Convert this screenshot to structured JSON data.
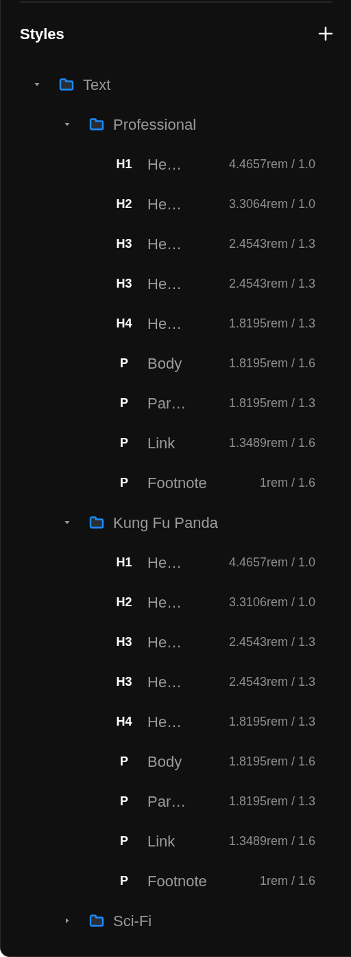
{
  "panel": {
    "title": "Styles"
  },
  "tree": [
    {
      "kind": "folder",
      "label": "Text",
      "expanded": true,
      "children": [
        {
          "kind": "folder",
          "label": "Professional",
          "expanded": true,
          "children": [
            {
              "kind": "style",
              "tag": "H1",
              "name": "He…",
              "size": "4.4657rem / 1.0"
            },
            {
              "kind": "style",
              "tag": "H2",
              "name": "He…",
              "size": "3.3064rem / 1.0"
            },
            {
              "kind": "style",
              "tag": "H3",
              "name": "He…",
              "size": "2.4543rem / 1.3"
            },
            {
              "kind": "style",
              "tag": "H3",
              "name": "He…",
              "size": "2.4543rem / 1.3"
            },
            {
              "kind": "style",
              "tag": "H4",
              "name": "He…",
              "size": "1.8195rem / 1.3"
            },
            {
              "kind": "style",
              "tag": "P",
              "name": "Body",
              "size": "1.8195rem / 1.6"
            },
            {
              "kind": "style",
              "tag": "P",
              "name": "Par…",
              "size": "1.8195rem / 1.3"
            },
            {
              "kind": "style",
              "tag": "P",
              "name": "Link",
              "size": "1.3489rem / 1.6"
            },
            {
              "kind": "style",
              "tag": "P",
              "name": "Footnote",
              "size": "1rem / 1.6"
            }
          ]
        },
        {
          "kind": "folder",
          "label": "Kung Fu Panda",
          "expanded": true,
          "children": [
            {
              "kind": "style",
              "tag": "H1",
              "name": "He…",
              "size": "4.4657rem / 1.0"
            },
            {
              "kind": "style",
              "tag": "H2",
              "name": "He…",
              "size": "3.3106rem / 1.0"
            },
            {
              "kind": "style",
              "tag": "H3",
              "name": "He…",
              "size": "2.4543rem / 1.3"
            },
            {
              "kind": "style",
              "tag": "H3",
              "name": "He…",
              "size": "2.4543rem / 1.3"
            },
            {
              "kind": "style",
              "tag": "H4",
              "name": "He…",
              "size": "1.8195rem / 1.3"
            },
            {
              "kind": "style",
              "tag": "P",
              "name": "Body",
              "size": "1.8195rem / 1.6"
            },
            {
              "kind": "style",
              "tag": "P",
              "name": "Par…",
              "size": "1.8195rem / 1.3"
            },
            {
              "kind": "style",
              "tag": "P",
              "name": "Link",
              "size": "1.3489rem / 1.6"
            },
            {
              "kind": "style",
              "tag": "P",
              "name": "Footnote",
              "size": "1rem / 1.6"
            }
          ]
        },
        {
          "kind": "folder",
          "label": "Sci-Fi",
          "expanded": false
        }
      ]
    }
  ]
}
